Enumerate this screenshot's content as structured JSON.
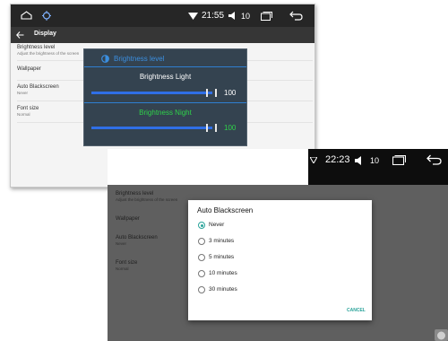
{
  "screen1": {
    "status": {
      "time": "21:55",
      "volume": "10"
    },
    "appbar": {
      "title": "Display"
    },
    "settings": [
      {
        "title": "Brightness level",
        "subtitle": "Adjust the brightness of the screen"
      },
      {
        "title": "Wallpaper"
      },
      {
        "title": "Auto Blackscreen",
        "subtitle": "Never"
      },
      {
        "title": "Font size",
        "subtitle": "Normal"
      }
    ],
    "brightness_dialog": {
      "title": "Brightness level",
      "light": {
        "label": "Brightness Light",
        "value": "100",
        "level": 1.0
      },
      "night": {
        "label": "Brightness Night",
        "value": "100",
        "level": 1.0
      }
    }
  },
  "screen2": {
    "status": {
      "time": "22:23",
      "volume": "10"
    },
    "settings": [
      {
        "title": "Brightness level",
        "subtitle": "Adjust the brightness of the screen"
      },
      {
        "title": "Wallpaper"
      },
      {
        "title": "Auto Blackscreen",
        "subtitle": "Never"
      },
      {
        "title": "Font size",
        "subtitle": "Normal"
      }
    ],
    "blackscreen_dialog": {
      "title": "Auto Blackscreen",
      "options": [
        "Never",
        "3 minutes",
        "5 minutes",
        "10 minutes",
        "30 minutes"
      ],
      "selected": "Never",
      "cancel_label": "CANCEL"
    }
  },
  "colors": {
    "accent_teal": "#2aa39a",
    "slider_blue": "#2f6fe6",
    "night_green": "#2fd24a",
    "dialog_title_blue": "#3b8fe0"
  }
}
